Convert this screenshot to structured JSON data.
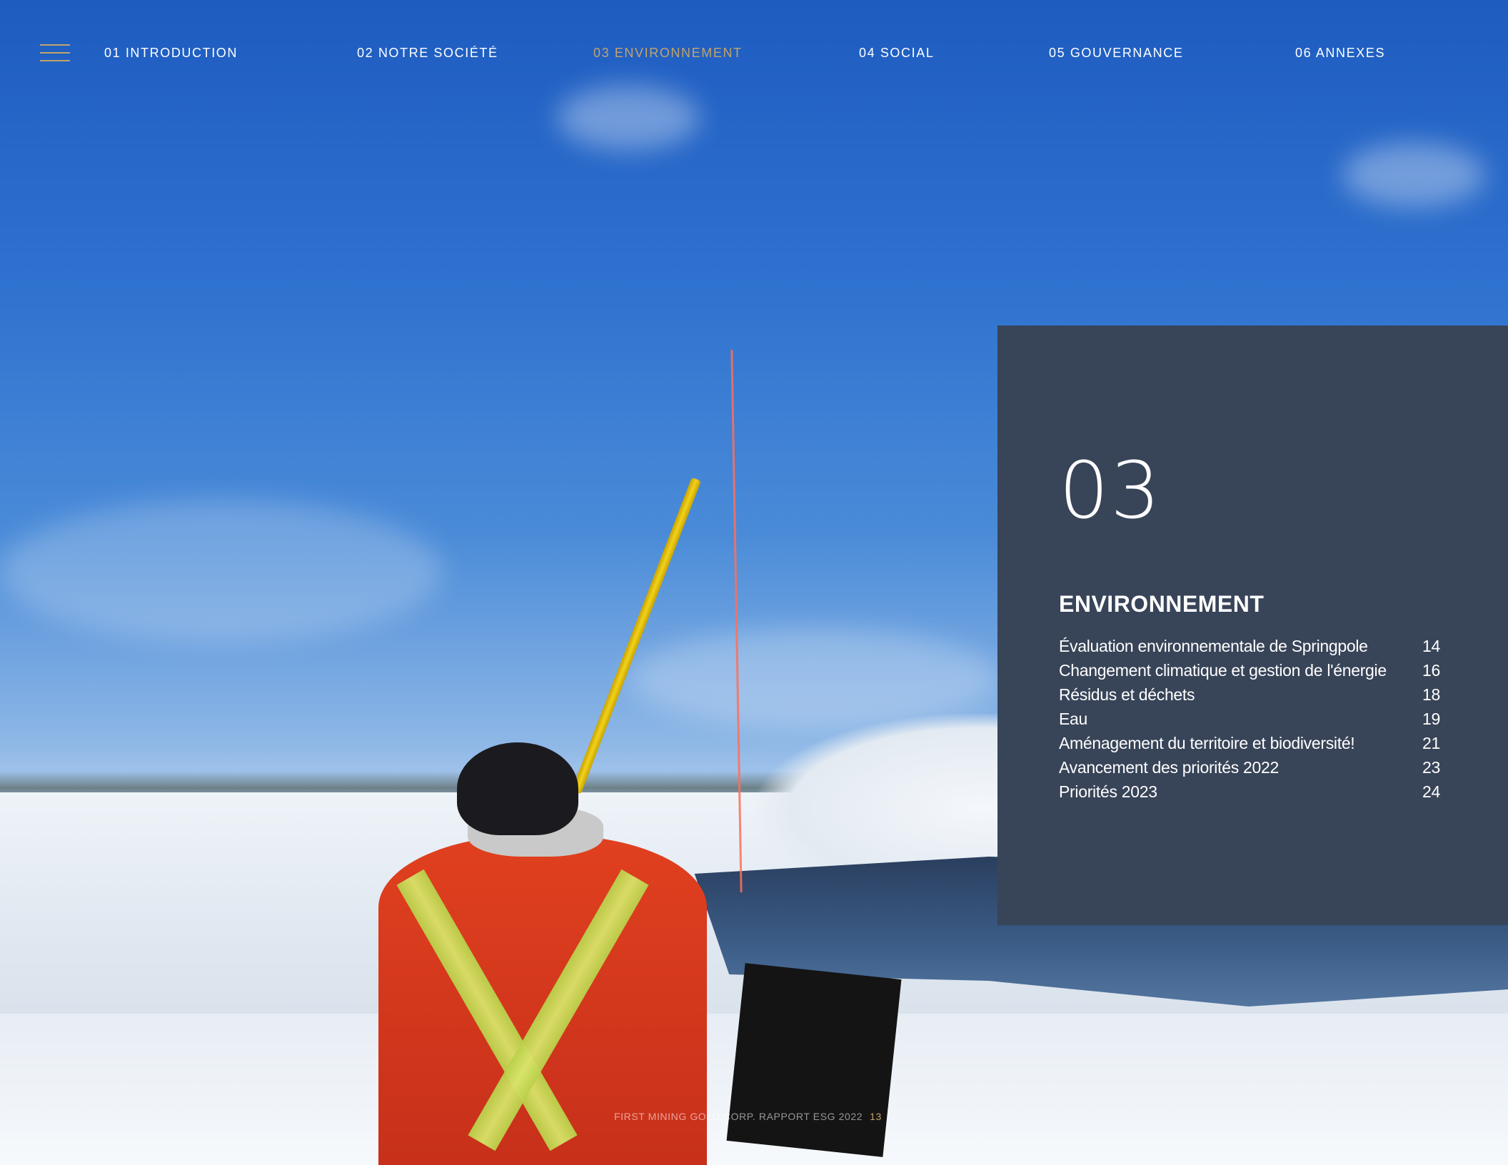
{
  "nav": {
    "items": [
      {
        "label": "01 INTRODUCTION",
        "active": false
      },
      {
        "label": "02 NOTRE SOCIÉTÉ",
        "active": false
      },
      {
        "label": "03 ENVIRONNEMENT",
        "active": true
      },
      {
        "label": "04 SOCIAL",
        "active": false
      },
      {
        "label": "05 GOUVERNANCE",
        "active": false
      },
      {
        "label": "06 ANNEXES",
        "active": false
      }
    ],
    "menu_icon": "hamburger-menu-icon"
  },
  "chapter": {
    "number": "03",
    "title": "ENVIRONNEMENT",
    "toc": [
      {
        "label": "Évaluation environnementale de Springpole",
        "page": "14"
      },
      {
        "label": "Changement climatique et gestion de l'énergie",
        "page": "16"
      },
      {
        "label": "Résidus et déchets",
        "page": "18"
      },
      {
        "label": "Eau",
        "page": "19"
      },
      {
        "label": "Aménagement du territoire et biodiversité!",
        "page": "21"
      },
      {
        "label": "Avancement des priorités 2022",
        "page": "23"
      },
      {
        "label": "Priorités 2023",
        "page": "24"
      }
    ]
  },
  "footer": {
    "text": "FIRST MINING GOLD CORP. RAPPORT ESG 2022",
    "page_number": "13"
  },
  "colors": {
    "accent_gold": "#c2a46a",
    "panel": "#384458",
    "text": "#ffffff"
  }
}
